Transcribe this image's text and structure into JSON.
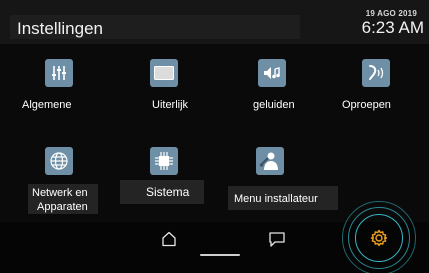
{
  "header": {
    "title": "Instellingen",
    "date": "19 AGO 2019",
    "time": "6:23 AM"
  },
  "tiles": [
    {
      "label": "Algemene",
      "icon": "sliders-icon",
      "color": "#6e8fa5"
    },
    {
      "label": "Uiterlijk",
      "icon": "display-icon",
      "color": "#6e8fa5"
    },
    {
      "label": "geluiden",
      "icon": "speaker-note-icon",
      "color": "#6e8fa5"
    },
    {
      "label": "Oproepen",
      "icon": "phone-signal-icon",
      "color": "#6e8fa5"
    },
    {
      "label_line1": "Netwerk en",
      "label_line2": "Apparaten",
      "icon": "globe-icon",
      "color": "#6e8fa5"
    },
    {
      "label": "Sistema",
      "icon": "chip-icon",
      "color": "#6e8fa5"
    },
    {
      "label": "Menu installateur",
      "icon": "installer-wrench-icon",
      "color": "#6e8fa5"
    }
  ],
  "navbar": {
    "icons": [
      "home-icon",
      "chat-icon",
      "settings-gear-icon"
    ],
    "accent": "#f0a020",
    "ring_color": "#37b6c7"
  }
}
